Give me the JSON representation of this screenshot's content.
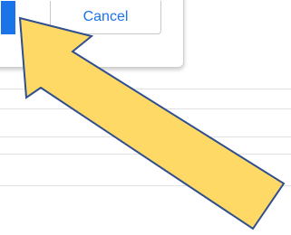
{
  "dialog": {
    "cancel_label": "Cancel"
  },
  "colors": {
    "accent": "#1a73e8",
    "arrow_fill": "#ffd966",
    "arrow_stroke": "#2f4f8f"
  },
  "icons": {
    "arrow": "arrow-pointer-icon"
  }
}
